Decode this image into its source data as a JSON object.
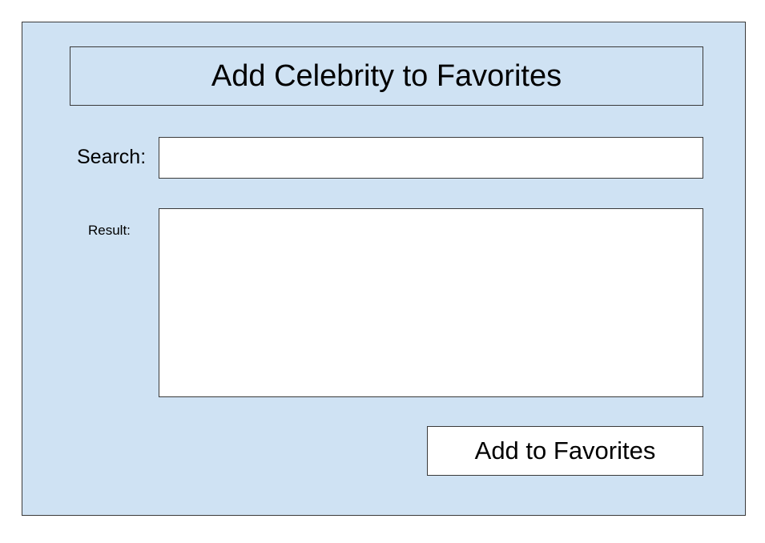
{
  "dialog": {
    "title": "Add Celebrity to Favorites",
    "background_color": "#cfe2f3"
  },
  "search": {
    "label": "Search:",
    "value": "",
    "placeholder": ""
  },
  "result": {
    "label": "Result:",
    "content": ""
  },
  "actions": {
    "add_label": "Add to Favorites"
  }
}
